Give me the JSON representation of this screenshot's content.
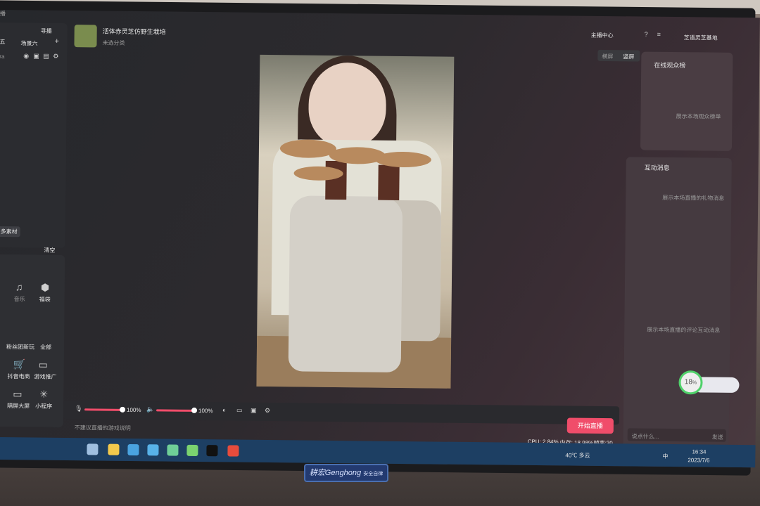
{
  "app": {
    "window_title_fragment": "播",
    "room_title": "活体赤灵芝仿野生栽培",
    "category": "未选分类",
    "user_name": "芝语灵芝基地",
    "anchor_center": "主播中心",
    "guide": "寻播"
  },
  "left": {
    "scene_label_partial": "五",
    "scene_tab": "场景六",
    "source_partial": "ra",
    "more_materials": "多素材",
    "clear": "清空",
    "music_label": "音乐",
    "mall_label": "福袋",
    "hot_line": "粉丝团新玩",
    "all_label": "全部",
    "douyin_shop": "抖音电商",
    "game_promo": "游戏推广",
    "ext_screen": "隔屏大屏",
    "mini_program": "小程序"
  },
  "preview": {
    "landscape": "横屏",
    "portrait": "竖屏"
  },
  "right": {
    "audience_title": "在线观众榜",
    "audience_placeholder": "展示本场观众榜单",
    "interact_title": "互动消息",
    "gift_placeholder": "展示本场直播的礼物消息",
    "comment_placeholder": "展示本场直播的评论互动消息",
    "chat_placeholder": "说点什么...",
    "send": "发送"
  },
  "controls": {
    "mic_volume": "100%",
    "speaker_volume": "100%",
    "mic_level": 1.0,
    "speaker_level": 1.0,
    "start_live": "开始直播",
    "hint": "不建议直播的游戏说明",
    "cpu": "CPU: 2.84%",
    "memory": "内存: 18.98%",
    "fps": "帧率:30"
  },
  "widget": {
    "percent": "18",
    "unit": "%"
  },
  "taskbar": {
    "weather": "40℃ 多云",
    "ime": "中",
    "time": "16:34",
    "date": "2023/7/6"
  },
  "monitor": {
    "brand": "耕宏Genghong",
    "brand_sub": "安全自律"
  }
}
